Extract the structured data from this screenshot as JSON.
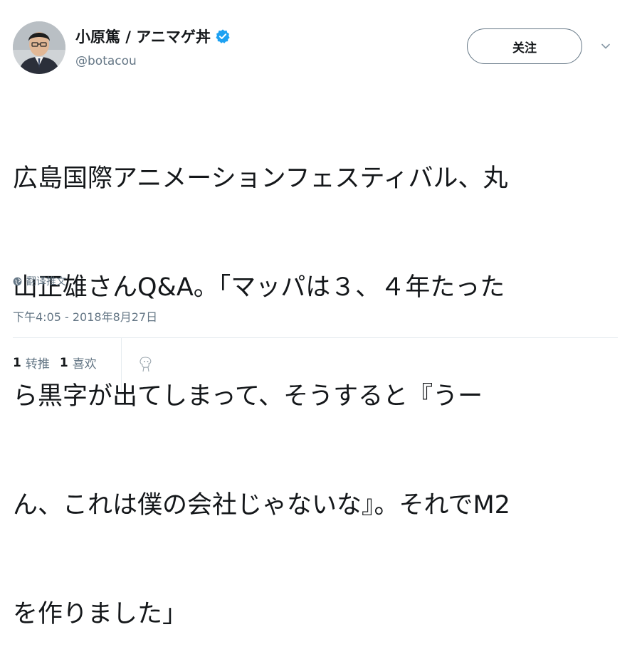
{
  "author": {
    "display_name": "小原篤 / アニマゲ丼",
    "handle": "@botacou",
    "avatar_icon": "person-avatar",
    "verified_icon": "verified-badge-icon",
    "verified_color": "#1da1f2"
  },
  "follow_button": {
    "label": "关注"
  },
  "tweet": {
    "text_lines": [
      "広島国際アニメーションフェスティバル、丸",
      "山正雄さんQ&A。「マッパは３、４年たった",
      "ら黒字が出てしまって、そうすると『うー",
      "ん、これは僕の会社じゃないな』。それでM2",
      "を作りました」"
    ]
  },
  "translate": {
    "label": "翻译推文",
    "icon": "globe-icon"
  },
  "timestamp": "下午4:05 - 2018年8月27日",
  "stats": {
    "retweets": {
      "count": "1",
      "label": "转推"
    },
    "likes": {
      "count": "1",
      "label": "喜欢"
    }
  },
  "colors": {
    "text": "#14171a",
    "secondary": "#657786",
    "divider": "#e6ecf0"
  }
}
